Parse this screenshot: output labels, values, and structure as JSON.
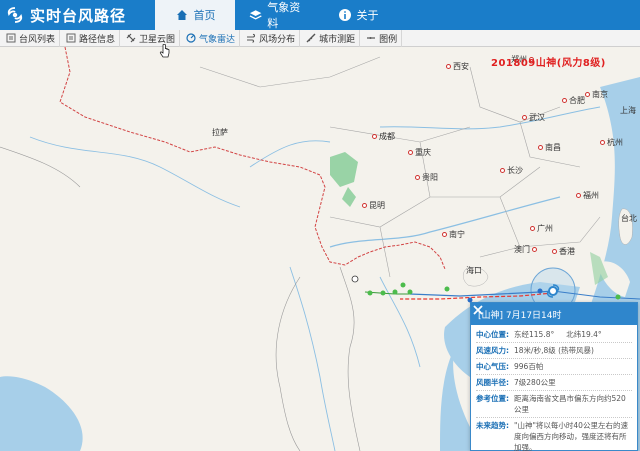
{
  "app": {
    "title": "实时台风路径"
  },
  "nav": {
    "tabs": [
      {
        "label": "首页",
        "icon": "home-icon",
        "active": true
      },
      {
        "label": "气象资料",
        "icon": "books-icon",
        "active": false
      },
      {
        "label": "关于",
        "icon": "info-icon",
        "active": false
      }
    ]
  },
  "toolbar": {
    "items": [
      {
        "label": "台风列表",
        "icon": "list-icon"
      },
      {
        "label": "路径信息",
        "icon": "list-icon"
      },
      {
        "label": "卫星云图",
        "icon": "satellite-icon"
      },
      {
        "label": "气象雷达",
        "icon": "radar-icon",
        "active": true
      },
      {
        "label": "风场分布",
        "icon": "wind-icon"
      },
      {
        "label": "城市测距",
        "icon": "ruler-icon"
      },
      {
        "label": "图例",
        "icon": "legend-icon"
      }
    ]
  },
  "map": {
    "typhoon_label": "201809山神(风力8级)",
    "cities": [
      "郑州",
      "西安",
      "合肥",
      "南京",
      "上海",
      "武汉",
      "成都",
      "杭州",
      "拉萨",
      "重庆",
      "南昌",
      "长沙",
      "贵阳",
      "福州",
      "昆明",
      "台北",
      "南宁",
      "广州",
      "澳门",
      "香港",
      "海口"
    ],
    "colors": {
      "accent": "#1a7dc9",
      "track": "#e8372f",
      "border": "#d24444",
      "water": "#a7cfe9"
    }
  },
  "popup": {
    "title": "[山神] 7月17日14时",
    "rows": [
      {
        "key": "中心位置:",
        "value": "东经115.8°",
        "value2": "北纬19.4°"
      },
      {
        "key": "风速风力:",
        "value": "18米/秒,8级 (热带风暴)"
      },
      {
        "key": "中心气压:",
        "value": "996百帕"
      },
      {
        "key": "风圈半径:",
        "value": "7级280公里"
      },
      {
        "key": "参考位置:",
        "value": "距离海南省文昌市偏东方向约520公里"
      },
      {
        "key": "未来趋势:",
        "value": "\"山神\"将以每小时40公里左右的速度向偏西方向移动，强度还将有所加强。"
      }
    ]
  }
}
